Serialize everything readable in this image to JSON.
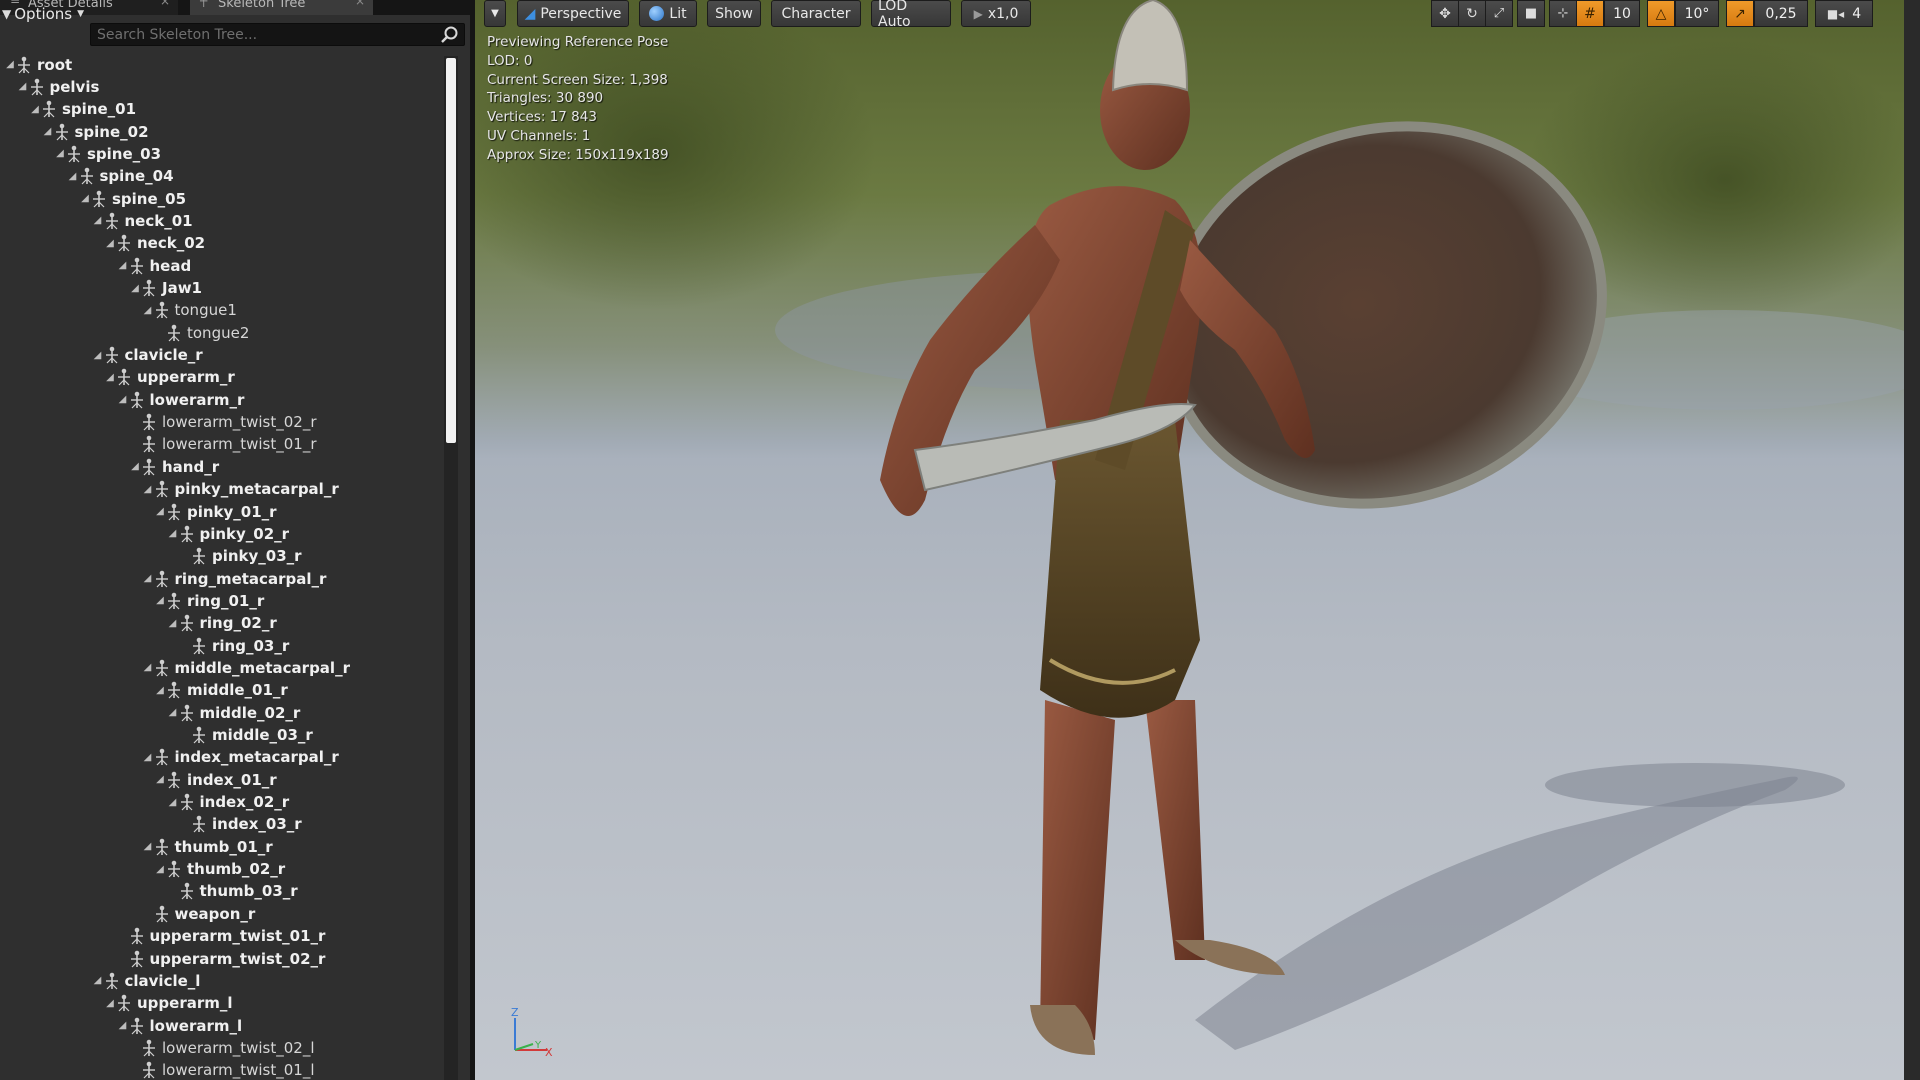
{
  "tabs": {
    "asset_details": "Asset Details",
    "skeleton_tree": "Skeleton Tree"
  },
  "skeleton_panel": {
    "options_label": "Options",
    "search_placeholder": "Search Skeleton Tree...",
    "bones": [
      {
        "name": "root",
        "depth": 0,
        "expanded": true,
        "bold": true
      },
      {
        "name": "pelvis",
        "depth": 1,
        "expanded": true,
        "bold": true
      },
      {
        "name": "spine_01",
        "depth": 2,
        "expanded": true,
        "bold": true
      },
      {
        "name": "spine_02",
        "depth": 3,
        "expanded": true,
        "bold": true
      },
      {
        "name": "spine_03",
        "depth": 4,
        "expanded": true,
        "bold": true
      },
      {
        "name": "spine_04",
        "depth": 5,
        "expanded": true,
        "bold": true
      },
      {
        "name": "spine_05",
        "depth": 6,
        "expanded": true,
        "bold": true
      },
      {
        "name": "neck_01",
        "depth": 7,
        "expanded": true,
        "bold": true
      },
      {
        "name": "neck_02",
        "depth": 8,
        "expanded": true,
        "bold": true
      },
      {
        "name": "head",
        "depth": 9,
        "expanded": true,
        "bold": true
      },
      {
        "name": "Jaw1",
        "depth": 10,
        "expanded": true,
        "bold": true
      },
      {
        "name": "tongue1",
        "depth": 11,
        "expanded": true,
        "bold": false
      },
      {
        "name": "tongue2",
        "depth": 12,
        "expanded": false,
        "bold": false
      },
      {
        "name": "clavicle_r",
        "depth": 7,
        "expanded": true,
        "bold": true
      },
      {
        "name": "upperarm_r",
        "depth": 8,
        "expanded": true,
        "bold": true
      },
      {
        "name": "lowerarm_r",
        "depth": 9,
        "expanded": true,
        "bold": true
      },
      {
        "name": "lowerarm_twist_02_r",
        "depth": 10,
        "expanded": false,
        "bold": false
      },
      {
        "name": "lowerarm_twist_01_r",
        "depth": 10,
        "expanded": false,
        "bold": false
      },
      {
        "name": "hand_r",
        "depth": 10,
        "expanded": true,
        "bold": true
      },
      {
        "name": "pinky_metacarpal_r",
        "depth": 11,
        "expanded": true,
        "bold": true
      },
      {
        "name": "pinky_01_r",
        "depth": 12,
        "expanded": true,
        "bold": true
      },
      {
        "name": "pinky_02_r",
        "depth": 13,
        "expanded": true,
        "bold": true
      },
      {
        "name": "pinky_03_r",
        "depth": 14,
        "expanded": false,
        "bold": true
      },
      {
        "name": "ring_metacarpal_r",
        "depth": 11,
        "expanded": true,
        "bold": true
      },
      {
        "name": "ring_01_r",
        "depth": 12,
        "expanded": true,
        "bold": true
      },
      {
        "name": "ring_02_r",
        "depth": 13,
        "expanded": true,
        "bold": true
      },
      {
        "name": "ring_03_r",
        "depth": 14,
        "expanded": false,
        "bold": true
      },
      {
        "name": "middle_metacarpal_r",
        "depth": 11,
        "expanded": true,
        "bold": true
      },
      {
        "name": "middle_01_r",
        "depth": 12,
        "expanded": true,
        "bold": true
      },
      {
        "name": "middle_02_r",
        "depth": 13,
        "expanded": true,
        "bold": true
      },
      {
        "name": "middle_03_r",
        "depth": 14,
        "expanded": false,
        "bold": true
      },
      {
        "name": "index_metacarpal_r",
        "depth": 11,
        "expanded": true,
        "bold": true
      },
      {
        "name": "index_01_r",
        "depth": 12,
        "expanded": true,
        "bold": true
      },
      {
        "name": "index_02_r",
        "depth": 13,
        "expanded": true,
        "bold": true
      },
      {
        "name": "index_03_r",
        "depth": 14,
        "expanded": false,
        "bold": true
      },
      {
        "name": "thumb_01_r",
        "depth": 11,
        "expanded": true,
        "bold": true
      },
      {
        "name": "thumb_02_r",
        "depth": 12,
        "expanded": true,
        "bold": true
      },
      {
        "name": "thumb_03_r",
        "depth": 13,
        "expanded": false,
        "bold": true
      },
      {
        "name": "weapon_r",
        "depth": 11,
        "expanded": false,
        "bold": true
      },
      {
        "name": "upperarm_twist_01_r",
        "depth": 9,
        "expanded": false,
        "bold": true
      },
      {
        "name": "upperarm_twist_02_r",
        "depth": 9,
        "expanded": false,
        "bold": true
      },
      {
        "name": "clavicle_l",
        "depth": 7,
        "expanded": true,
        "bold": true
      },
      {
        "name": "upperarm_l",
        "depth": 8,
        "expanded": true,
        "bold": true
      },
      {
        "name": "lowerarm_l",
        "depth": 9,
        "expanded": true,
        "bold": true
      },
      {
        "name": "lowerarm_twist_02_l",
        "depth": 10,
        "expanded": false,
        "bold": false
      },
      {
        "name": "lowerarm_twist_01_l",
        "depth": 10,
        "expanded": false,
        "bold": false
      }
    ]
  },
  "viewport": {
    "toolbar": {
      "perspective": "Perspective",
      "lit": "Lit",
      "show": "Show",
      "character": "Character",
      "lod": "LOD Auto",
      "speed": "x1,0",
      "grid_snap_value": "10",
      "rotation_snap_value": "10°",
      "scale_snap_value": "0,25",
      "camera_speed_value": "4"
    },
    "stats": [
      "Previewing Reference Pose",
      "LOD: 0",
      "Current Screen Size: 1,398",
      "Triangles: 30 890",
      "Vertices: 17 843",
      "UV Channels: 1",
      "Approx Size: 150x119x189"
    ],
    "axis_labels": {
      "z": "Z",
      "x": "X",
      "y": "Y"
    }
  },
  "colors": {
    "accent_blue": "#3d8fe0",
    "accent_orange": "#e88a1a",
    "panel_bg": "#2f2f2f"
  }
}
